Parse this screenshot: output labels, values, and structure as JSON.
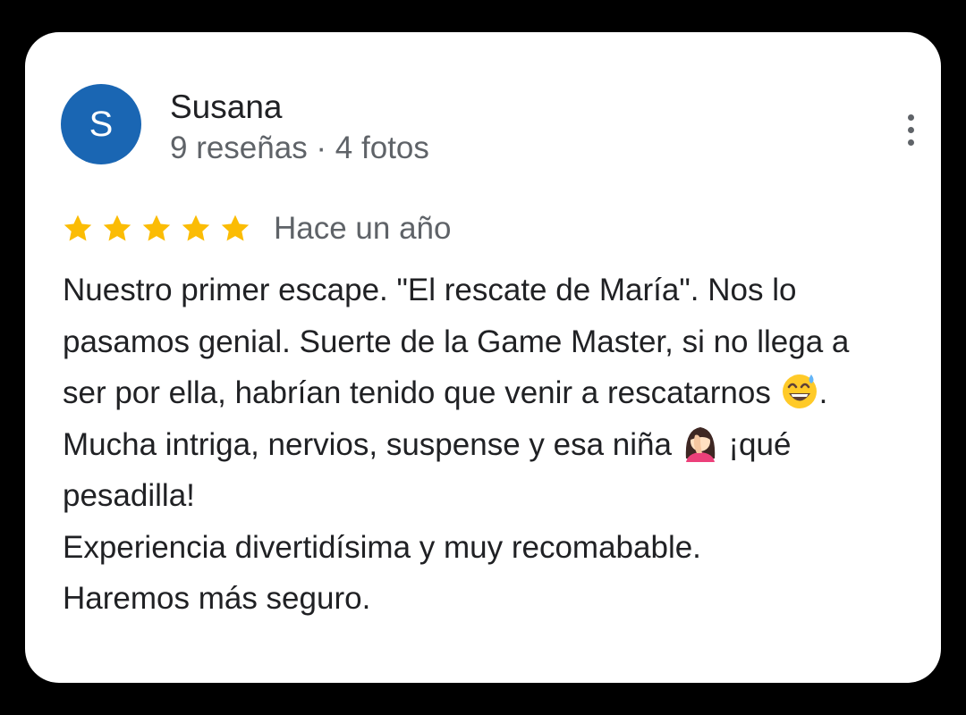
{
  "review": {
    "author": {
      "initial": "S",
      "name": "Susana",
      "meta": "9 reseñas · 4 fotos"
    },
    "rating": 5,
    "date": "Hace un año",
    "menu_icon": "more-vert-icon",
    "text": {
      "line1": "Nuestro primer escape. \"El rescate de María\". Nos lo",
      "line2": "pasamos genial. Suerte de la Game Master, si no llega a",
      "line3_before": "ser por ella, habrían tenido que venir a rescatarnos ",
      "line3_after": ".",
      "line4_before": "Mucha intriga, nervios, suspense y esa niña ",
      "line4_after": " ¡qué",
      "line5": "pesadilla!",
      "line6": "Experiencia divertidísima y muy recomabable.",
      "line7": "Haremos más seguro."
    },
    "emojis": [
      "grinning-sweat-emoji",
      "facepalm-woman-emoji"
    ]
  },
  "colors": {
    "avatar": "#1a66b3",
    "star": "#fbbc04",
    "secondary_text": "#5f6368",
    "primary_text": "#202124"
  }
}
